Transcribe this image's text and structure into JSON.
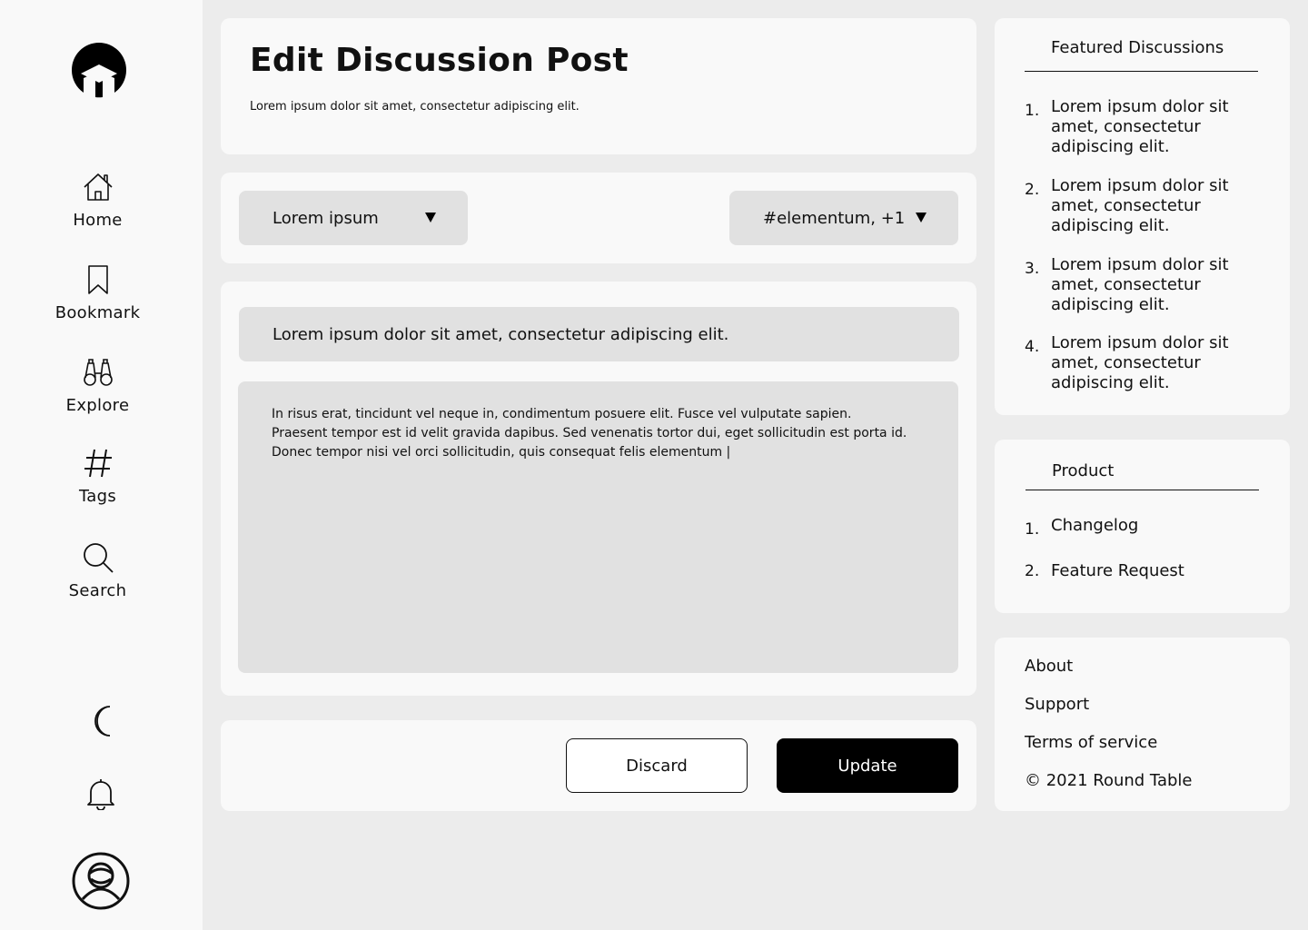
{
  "sidebar": {
    "logo": "round-table-logo",
    "nav": [
      {
        "label": "Home",
        "icon": "home-icon"
      },
      {
        "label": "Bookmark",
        "icon": "bookmark-icon"
      },
      {
        "label": "Explore",
        "icon": "binoculars-icon"
      },
      {
        "label": "Tags",
        "icon": "hash-icon"
      },
      {
        "label": "Search",
        "icon": "search-icon"
      }
    ],
    "bottom_icons": [
      "moon-icon",
      "bell-icon",
      "user-avatar-icon"
    ]
  },
  "header": {
    "title": "Edit Discussion Post",
    "subtitle": "Lorem ipsum dolor sit amet, consectetur adipiscing elit."
  },
  "filters": {
    "category": "Lorem ipsum",
    "tags": "#elementum, +1"
  },
  "editor": {
    "title_value": "Lorem ipsum dolor sit amet, consectetur adipiscing elit.",
    "body_value": "In risus erat, tincidunt vel neque in, condimentum posuere elit. Fusce vel vulputate sapien. Praesent tempor est id velit gravida dapibus. Sed venenatis tortor dui, eget sollicitudin est porta id. Donec tempor nisi vel orci sollicitudin, quis consequat felis elementum |"
  },
  "actions": {
    "discard": "Discard",
    "update": "Update"
  },
  "featured": {
    "title": "Featured Discussions",
    "items": [
      {
        "num": "1.",
        "text": "Lorem ipsum dolor sit amet, consectetur adipiscing elit."
      },
      {
        "num": "2.",
        "text": "Lorem ipsum dolor sit amet, consectetur adipiscing elit."
      },
      {
        "num": "3.",
        "text": "Lorem ipsum dolor sit amet, consectetur adipiscing elit."
      },
      {
        "num": "4.",
        "text": "Lorem ipsum dolor sit amet, consectetur adipiscing elit."
      }
    ]
  },
  "product": {
    "title": "Product",
    "items": [
      {
        "num": "1.",
        "text": "Changelog"
      },
      {
        "num": "2.",
        "text": "Feature Request"
      }
    ]
  },
  "footer": {
    "links": [
      "About",
      "Support",
      "Terms of service"
    ],
    "copyright": "© 2021 Round Table"
  },
  "colors": {
    "background": "#ececec",
    "card": "#f9f9f9",
    "field": "#e1e1e1",
    "primary": "#000000"
  }
}
